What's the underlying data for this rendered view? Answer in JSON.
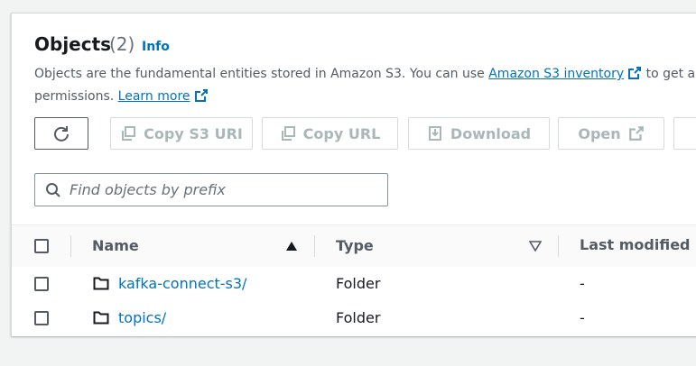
{
  "header": {
    "title": "Objects",
    "count": "(2)",
    "info": "Info"
  },
  "description": {
    "line1_prefix": "Objects are the fundamental entities stored in Amazon S3. You can use",
    "inventory_link": "Amazon S3 inventory",
    "line1_suffix": "to get a list of a",
    "line2_prefix": "permissions.",
    "learn_more": "Learn more"
  },
  "toolbar": {
    "copy_s3_uri": "Copy S3 URI",
    "copy_url": "Copy URL",
    "download": "Download",
    "open": "Open"
  },
  "search": {
    "placeholder": "Find objects by prefix",
    "value": ""
  },
  "table": {
    "columns": {
      "name": "Name",
      "type": "Type",
      "last_modified": "Last modified"
    },
    "rows": [
      {
        "name": "kafka-connect-s3/",
        "type": "Folder",
        "last_modified": "-"
      },
      {
        "name": "topics/",
        "type": "Folder",
        "last_modified": "-"
      }
    ]
  },
  "colors": {
    "link": "#0073bb",
    "text": "#16191f",
    "muted": "#545b64",
    "disabled": "#aab7b8",
    "border": "#d5dbdb",
    "background": "#f2f3f3"
  },
  "icons": {
    "refresh": "refresh-icon",
    "copy": "copy-icon",
    "download": "download-icon",
    "external": "external-link-icon",
    "search": "search-icon",
    "folder": "folder-icon",
    "sort_asc": "sort-ascending-icon",
    "sort_desc": "sort-descending-icon"
  }
}
